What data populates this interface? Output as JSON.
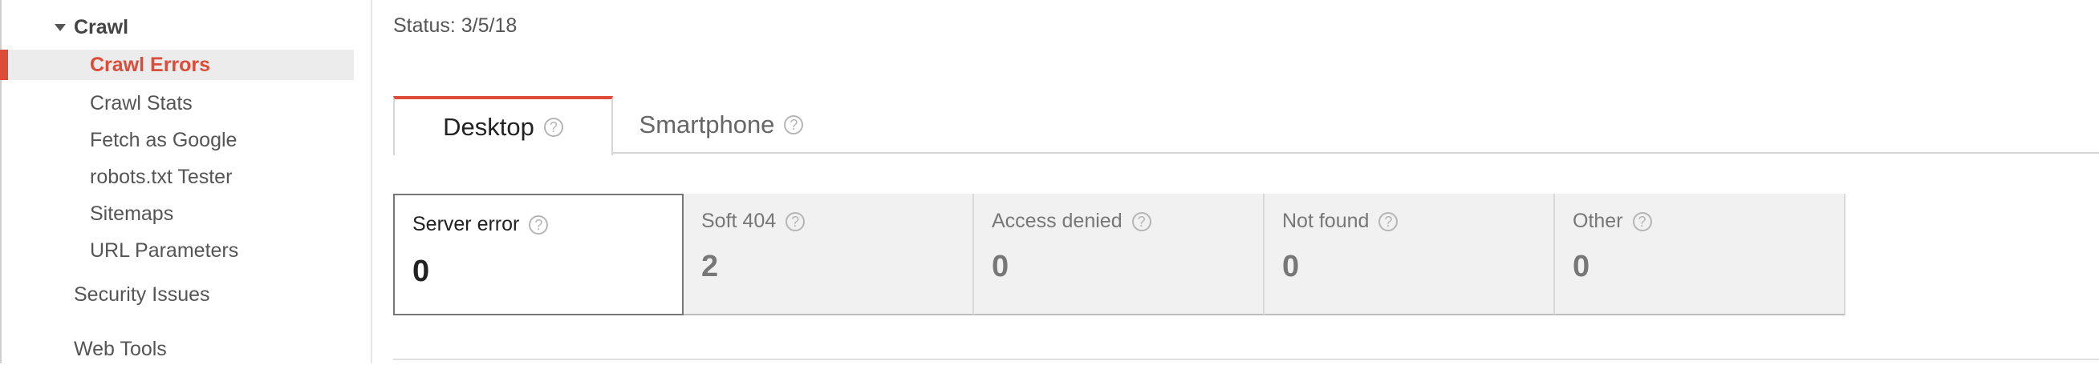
{
  "sidebar": {
    "section_label": "Crawl",
    "items": [
      {
        "label": "Crawl Errors",
        "active": true
      },
      {
        "label": "Crawl Stats"
      },
      {
        "label": "Fetch as Google"
      },
      {
        "label": "robots.txt Tester"
      },
      {
        "label": "Sitemaps"
      },
      {
        "label": "URL Parameters"
      }
    ],
    "top_items": [
      {
        "label": "Security Issues"
      },
      {
        "label": "Web Tools"
      }
    ]
  },
  "status": "Status: 3/5/18",
  "tabs": [
    {
      "label": "Desktop",
      "selected": true
    },
    {
      "label": "Smartphone"
    }
  ],
  "cards": [
    {
      "label": "Server error",
      "value": "0",
      "selected": true
    },
    {
      "label": "Soft 404",
      "value": "2"
    },
    {
      "label": "Access denied",
      "value": "0"
    },
    {
      "label": "Not found",
      "value": "0"
    },
    {
      "label": "Other",
      "value": "0"
    }
  ],
  "colors": {
    "accent": "#dd4b39"
  }
}
